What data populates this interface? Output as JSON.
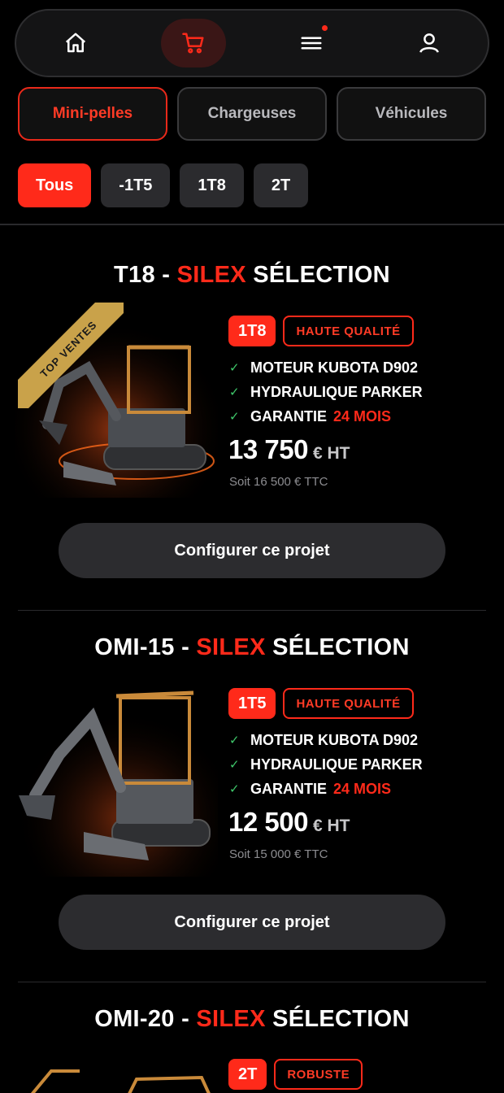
{
  "colors": {
    "accent": "#ff2a1a",
    "check": "#3fc86b",
    "background": "#000000"
  },
  "nav": {
    "items": [
      {
        "icon": "home-icon"
      },
      {
        "icon": "cart-icon",
        "active": true
      },
      {
        "icon": "menu-icon",
        "notification": true
      },
      {
        "icon": "user-icon"
      }
    ]
  },
  "categories": [
    "Mini-pelles",
    "Chargeuses",
    "Véhicules"
  ],
  "filters": [
    "Tous",
    "-1T5",
    "1T8",
    "2T"
  ],
  "products": [
    {
      "model": "T18 -",
      "brand": "SILEX",
      "tier": "SÉLECTION",
      "ribbon": "TOP VENTES",
      "size_badge": "1T8",
      "quality_badge": "HAUTE QUALITÉ",
      "features": [
        {
          "text": "MOTEUR KUBOTA D902",
          "highlight": ""
        },
        {
          "text": "HYDRAULIQUE PARKER",
          "highlight": ""
        },
        {
          "text": "GARANTIE",
          "highlight": "24 MOIS"
        }
      ],
      "price": "13 750",
      "price_unit": "€ HT",
      "price_ttc": "Soit 16 500 € TTC",
      "cta": "Configurer ce projet"
    },
    {
      "model": "OMI-15 -",
      "brand": "SILEX",
      "tier": "SÉLECTION",
      "size_badge": "1T5",
      "quality_badge": "HAUTE QUALITÉ",
      "features": [
        {
          "text": "MOTEUR KUBOTA D902",
          "highlight": ""
        },
        {
          "text": "HYDRAULIQUE PARKER",
          "highlight": ""
        },
        {
          "text": "GARANTIE",
          "highlight": "24 MOIS"
        }
      ],
      "price": "12 500",
      "price_unit": "€ HT",
      "price_ttc": "Soit 15 000 € TTC",
      "cta": "Configurer ce projet"
    },
    {
      "model": "OMI-20 -",
      "brand": "SILEX",
      "tier": "SÉLECTION",
      "size_badge": "2T",
      "quality_badge": "ROBUSTE"
    }
  ]
}
